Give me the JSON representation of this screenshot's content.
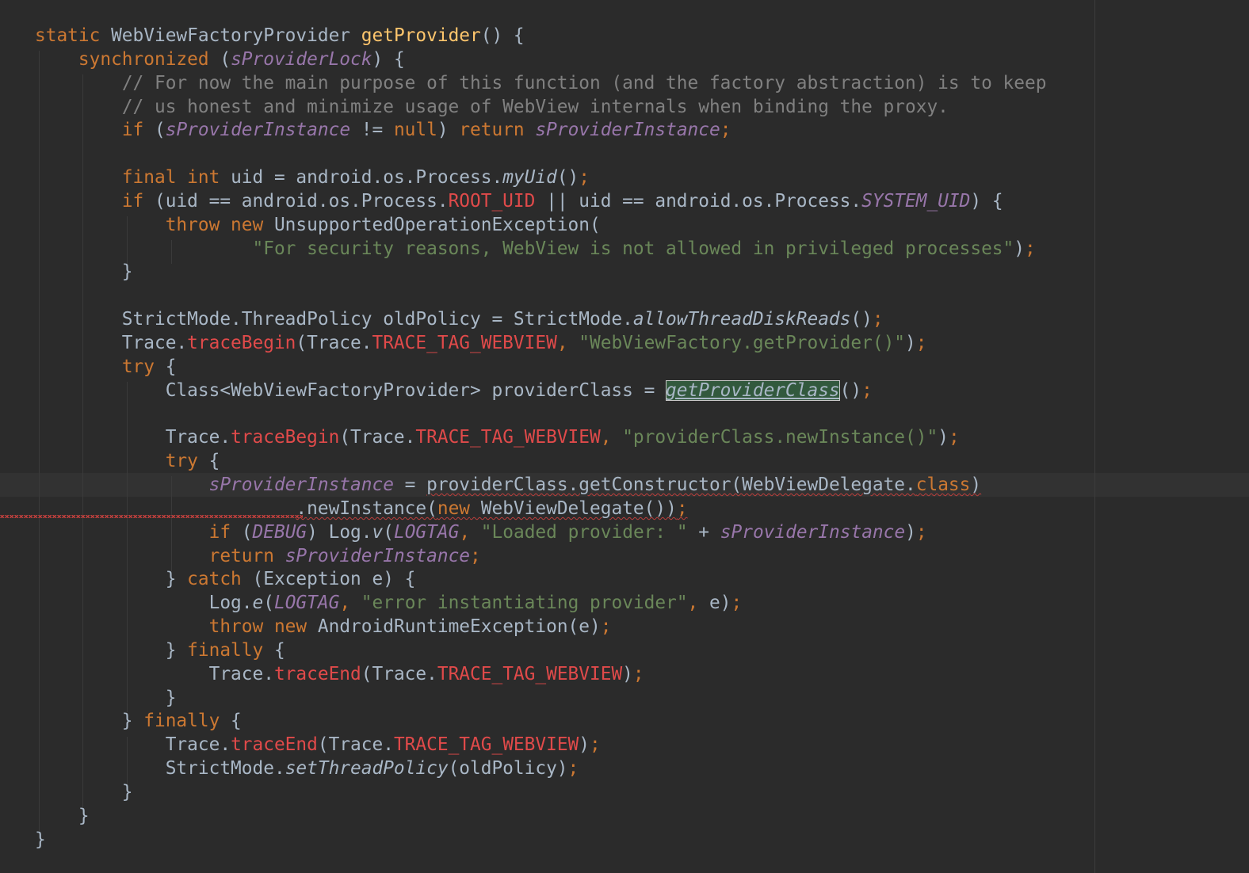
{
  "editor": {
    "language": "Java",
    "colors": {
      "background": "#2b2b2b",
      "keyword": "#cc7832",
      "method_decl": "#ffc66d",
      "field": "#9876aa",
      "comment": "#808080",
      "string": "#6a8759",
      "constant": "#e04a4a",
      "text": "#a9b7c6"
    },
    "lines": [
      [
        [
          "kw",
          "static"
        ],
        [
          "t",
          " WebViewFactoryProvider "
        ],
        [
          "fn",
          "getProvider"
        ],
        [
          "t",
          "() {"
        ]
      ],
      [
        [
          "t",
          "    "
        ],
        [
          "kw",
          "synchronized"
        ],
        [
          "t",
          " ("
        ],
        [
          "fld",
          "sProviderLock"
        ],
        [
          "t",
          ") {"
        ]
      ],
      [
        [
          "t",
          "        "
        ],
        [
          "cmt",
          "// For now the main purpose of this function (and the factory abstraction) is to keep"
        ]
      ],
      [
        [
          "t",
          "        "
        ],
        [
          "cmt",
          "// us honest and minimize usage of WebView internals when binding the proxy."
        ]
      ],
      [
        [
          "t",
          "        "
        ],
        [
          "kw",
          "if"
        ],
        [
          "t",
          " ("
        ],
        [
          "fld",
          "sProviderInstance"
        ],
        [
          "t",
          " != "
        ],
        [
          "kw",
          "null"
        ],
        [
          "t",
          ") "
        ],
        [
          "kw",
          "return"
        ],
        [
          "t",
          " "
        ],
        [
          "fld",
          "sProviderInstance"
        ],
        [
          "kw",
          ";"
        ]
      ],
      [
        [
          "t",
          ""
        ]
      ],
      [
        [
          "t",
          "        "
        ],
        [
          "kw",
          "final int"
        ],
        [
          "t",
          " uid = android.os.Process."
        ],
        [
          "it",
          "myUid"
        ],
        [
          "t",
          "()"
        ],
        [
          "kw",
          ";"
        ]
      ],
      [
        [
          "t",
          "        "
        ],
        [
          "kw",
          "if"
        ],
        [
          "t",
          " (uid == android.os.Process."
        ],
        [
          "red",
          "ROOT_UID"
        ],
        [
          "t",
          " || uid == android.os.Process."
        ],
        [
          "fld",
          "SYSTEM_UID"
        ],
        [
          "t",
          ") {"
        ]
      ],
      [
        [
          "t",
          "            "
        ],
        [
          "kw",
          "throw new"
        ],
        [
          "t",
          " UnsupportedOperationException("
        ]
      ],
      [
        [
          "t",
          "                    "
        ],
        [
          "str",
          "\"For security reasons, WebView is not allowed in privileged processes\""
        ],
        [
          "t",
          ")"
        ],
        [
          "kw",
          ";"
        ]
      ],
      [
        [
          "t",
          "        }"
        ]
      ],
      [
        [
          "t",
          ""
        ]
      ],
      [
        [
          "t",
          "        StrictMode.ThreadPolicy oldPolicy = StrictMode."
        ],
        [
          "it",
          "allowThreadDiskReads"
        ],
        [
          "t",
          "()"
        ],
        [
          "kw",
          ";"
        ]
      ],
      [
        [
          "t",
          "        Trace."
        ],
        [
          "red",
          "traceBegin"
        ],
        [
          "t",
          "(Trace."
        ],
        [
          "red",
          "TRACE_TAG_WEBVIEW"
        ],
        [
          "kw",
          ","
        ],
        [
          "t",
          " "
        ],
        [
          "str",
          "\"WebViewFactory.getProvider()\""
        ],
        [
          "t",
          ")"
        ],
        [
          "kw",
          ";"
        ]
      ],
      [
        [
          "t",
          "        "
        ],
        [
          "kw",
          "try"
        ],
        [
          "t",
          " {"
        ]
      ],
      [
        [
          "t",
          "            Class<WebViewFactoryProvider> providerClass = "
        ],
        [
          "sel",
          "getProviderClass"
        ],
        [
          "t",
          "()"
        ],
        [
          "kw",
          ";"
        ]
      ],
      [
        [
          "t",
          ""
        ]
      ],
      [
        [
          "t",
          "            Trace."
        ],
        [
          "red",
          "traceBegin"
        ],
        [
          "t",
          "(Trace."
        ],
        [
          "red",
          "TRACE_TAG_WEBVIEW"
        ],
        [
          "kw",
          ","
        ],
        [
          "t",
          " "
        ],
        [
          "str",
          "\"providerClass.newInstance()\""
        ],
        [
          "t",
          ")"
        ],
        [
          "kw",
          ";"
        ]
      ],
      [
        [
          "t",
          "            "
        ],
        [
          "kw",
          "try"
        ],
        [
          "t",
          " {"
        ]
      ],
      [
        [
          "t",
          "                "
        ],
        [
          "fld",
          "sProviderInstance"
        ],
        [
          "t",
          " = "
        ],
        [
          "sq",
          "providerClass.getConstructor(WebViewDelegate."
        ],
        [
          "sqkw",
          "class"
        ],
        [
          "sq",
          ")"
        ]
      ],
      [
        [
          "t",
          "                        "
        ],
        [
          "sq",
          "."
        ],
        [
          "sq",
          "newInstance("
        ],
        [
          "sqkw",
          "new"
        ],
        [
          "sq",
          " WebViewDelegate())"
        ],
        [
          "sqkw",
          ";"
        ]
      ],
      [
        [
          "t",
          "                "
        ],
        [
          "kw",
          "if"
        ],
        [
          "t",
          " ("
        ],
        [
          "fld",
          "DEBUG"
        ],
        [
          "t",
          ") Log."
        ],
        [
          "it",
          "v"
        ],
        [
          "t",
          "("
        ],
        [
          "fld",
          "LOGTAG"
        ],
        [
          "kw",
          ","
        ],
        [
          "t",
          " "
        ],
        [
          "str",
          "\"Loaded provider: \""
        ],
        [
          "t",
          " + "
        ],
        [
          "fld",
          "sProviderInstance"
        ],
        [
          "t",
          ")"
        ],
        [
          "kw",
          ";"
        ]
      ],
      [
        [
          "t",
          "                "
        ],
        [
          "kw",
          "return"
        ],
        [
          "t",
          " "
        ],
        [
          "fld",
          "sProviderInstance"
        ],
        [
          "kw",
          ";"
        ]
      ],
      [
        [
          "t",
          "            } "
        ],
        [
          "kw",
          "catch"
        ],
        [
          "t",
          " (Exception e) {"
        ]
      ],
      [
        [
          "t",
          "                Log."
        ],
        [
          "it",
          "e"
        ],
        [
          "t",
          "("
        ],
        [
          "fld",
          "LOGTAG"
        ],
        [
          "kw",
          ","
        ],
        [
          "t",
          " "
        ],
        [
          "str",
          "\"error instantiating provider\""
        ],
        [
          "kw",
          ","
        ],
        [
          "t",
          " e)"
        ],
        [
          "kw",
          ";"
        ]
      ],
      [
        [
          "t",
          "                "
        ],
        [
          "kw",
          "throw new"
        ],
        [
          "t",
          " AndroidRuntimeException(e)"
        ],
        [
          "kw",
          ";"
        ]
      ],
      [
        [
          "t",
          "            } "
        ],
        [
          "kw",
          "finally"
        ],
        [
          "t",
          " {"
        ]
      ],
      [
        [
          "t",
          "                Trace."
        ],
        [
          "red",
          "traceEnd"
        ],
        [
          "t",
          "(Trace."
        ],
        [
          "red",
          "TRACE_TAG_WEBVIEW"
        ],
        [
          "t",
          ")"
        ],
        [
          "kw",
          ";"
        ]
      ],
      [
        [
          "t",
          "            }"
        ]
      ],
      [
        [
          "t",
          "        } "
        ],
        [
          "kw",
          "finally"
        ],
        [
          "t",
          " {"
        ]
      ],
      [
        [
          "t",
          "            Trace."
        ],
        [
          "red",
          "traceEnd"
        ],
        [
          "t",
          "(Trace."
        ],
        [
          "red",
          "TRACE_TAG_WEBVIEW"
        ],
        [
          "t",
          ")"
        ],
        [
          "kw",
          ";"
        ]
      ],
      [
        [
          "t",
          "            StrictMode."
        ],
        [
          "it",
          "setThreadPolicy"
        ],
        [
          "t",
          "(oldPolicy)"
        ],
        [
          "kw",
          ";"
        ]
      ],
      [
        [
          "t",
          "        }"
        ]
      ],
      [
        [
          "t",
          "    }"
        ]
      ],
      [
        [
          "t",
          "}"
        ]
      ]
    ]
  }
}
